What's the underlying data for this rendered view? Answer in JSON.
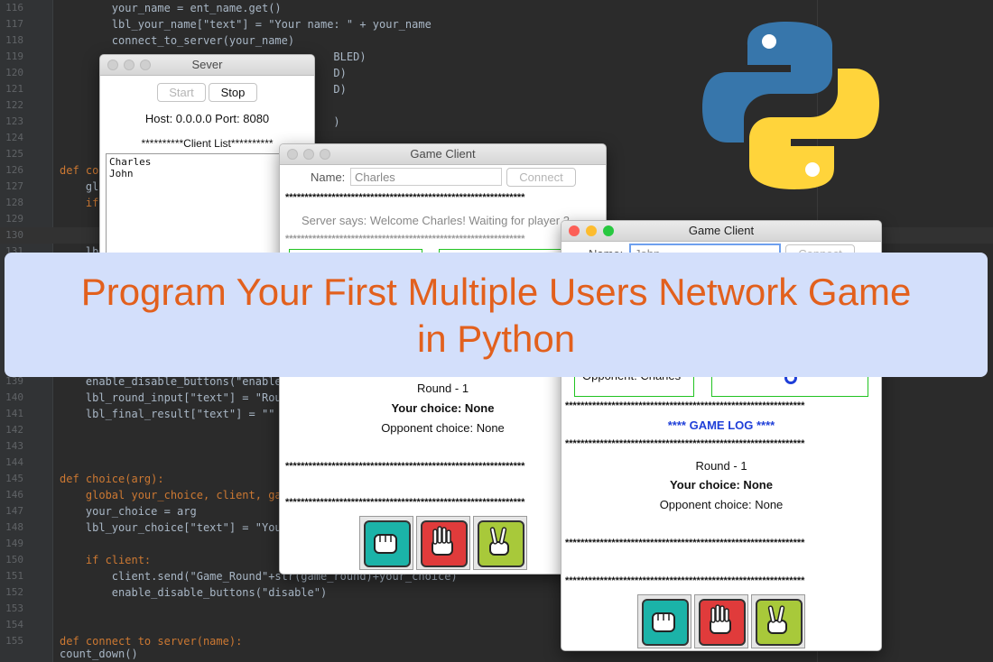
{
  "code_lines": [
    {
      "num": "116",
      "text": "        your_name = ent_name.get()"
    },
    {
      "num": "117",
      "text": "        lbl_your_name[\"text\"] = \"Your name: \" + your_name"
    },
    {
      "num": "118",
      "text": "        connect_to_server(your_name)"
    },
    {
      "num": "119",
      "text": "                                          BLED)"
    },
    {
      "num": "120",
      "text": "                                          D)"
    },
    {
      "num": "121",
      "text": "                                          D)"
    },
    {
      "num": "122",
      "text": ""
    },
    {
      "num": "123",
      "text": "                                          )"
    },
    {
      "num": "124",
      "text": ""
    },
    {
      "num": "125",
      "text": ""
    },
    {
      "num": "126",
      "text": "def co"
    },
    {
      "num": "127",
      "text": "    gl"
    },
    {
      "num": "128",
      "text": "    if"
    },
    {
      "num": "129",
      "text": ""
    },
    {
      "num": "130",
      "text": ""
    },
    {
      "num": "131",
      "text": "    lb"
    },
    {
      "num": "139",
      "text": "    enable_disable_buttons(\"enable\""
    },
    {
      "num": "140",
      "text": "    lbl_round_input[\"text\"] = \"Roun"
    },
    {
      "num": "141",
      "text": "    lbl_final_result[\"text\"] = \"\""
    },
    {
      "num": "142",
      "text": ""
    },
    {
      "num": "143",
      "text": ""
    },
    {
      "num": "144",
      "text": ""
    },
    {
      "num": "145",
      "text": "def choice(arg):"
    },
    {
      "num": "146",
      "text": "    global your_choice, client, gam"
    },
    {
      "num": "147",
      "text": "    your_choice = arg"
    },
    {
      "num": "148",
      "text": "    lbl_your_choice[\"text\"] = \"Your"
    },
    {
      "num": "149",
      "text": ""
    },
    {
      "num": "150",
      "text": "    if client:"
    },
    {
      "num": "151",
      "text": "        client.send(\"Game_Round\"+str(game_round)+your_choice)"
    },
    {
      "num": "152",
      "text": "        enable_disable_buttons(\"disable\")"
    },
    {
      "num": "153",
      "text": ""
    },
    {
      "num": "154",
      "text": ""
    },
    {
      "num": "155",
      "text": "def connect to server(name):"
    },
    {
      "num": "",
      "text": "count_down()"
    }
  ],
  "server_window": {
    "title": "Sever",
    "start_label": "Start",
    "stop_label": "Stop",
    "host_text": "Host: 0.0.0.0  Port: 8080",
    "client_list_header": "**********Client List**********",
    "clients": [
      "Charles",
      "John"
    ]
  },
  "client1": {
    "title": "Game Client",
    "name_label": "Name:",
    "name_value": "Charles",
    "connect_label": "Connect",
    "stars": "**************************************************************",
    "server_says": "Server says: Welcome Charles! Waiting for player 2",
    "dotted": "**************************************************************",
    "round": "Round - 1",
    "your_choice": "Your choice: None",
    "opponent_choice": "Opponent choice: None",
    "stars2": "**************************************************************",
    "stars3": "**************************************************************"
  },
  "client2": {
    "title": "Game Client",
    "name_label": "Name:",
    "name_value": "John",
    "connect_label": "Connect",
    "opponent_label": "Opponent: Charles",
    "stars_a": "**************************************************************",
    "game_log": "**** GAME LOG ****",
    "stars_b": "**************************************************************",
    "round": "Round - 1",
    "your_choice": "Your choice: None",
    "opponent_choice": "Opponent choice: None",
    "stars_c": "**************************************************************",
    "stars_d": "**************************************************************"
  },
  "banner": {
    "line1": "Program Your First Multiple Users Network Game",
    "line2": "in Python"
  },
  "colors": {
    "banner_text": "#e2601d",
    "banner_bg": "#d3dffb",
    "game_log_text": "#1f3fd8",
    "python_blue": "#3776ab",
    "python_yellow": "#ffd43b"
  }
}
